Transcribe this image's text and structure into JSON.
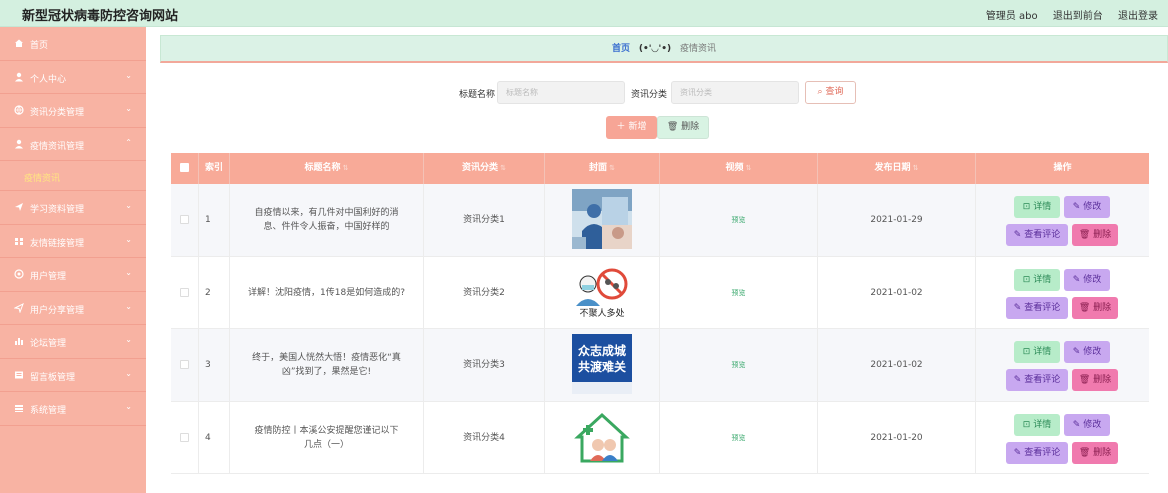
{
  "header": {
    "site_title": "新型冠状病毒防控咨询网站",
    "admin_label": "管理员 abo",
    "to_front_label": "退出到前台",
    "logout_label": "退出登录"
  },
  "sidebar": {
    "items": [
      {
        "label": "首页",
        "icon": "home-icon",
        "has_children": false
      },
      {
        "label": "个人中心",
        "icon": "user-icon",
        "has_children": true
      },
      {
        "label": "资讯分类管理",
        "icon": "globe-icon",
        "has_children": true
      },
      {
        "label": "疫情资讯管理",
        "icon": "user-icon",
        "has_children": true,
        "expanded": true,
        "children": [
          "疫情资讯"
        ]
      },
      {
        "label": "学习资料管理",
        "icon": "send-icon",
        "has_children": true
      },
      {
        "label": "友情链接管理",
        "icon": "grid-icon",
        "has_children": true
      },
      {
        "label": "用户管理",
        "icon": "circle-icon",
        "has_children": true
      },
      {
        "label": "用户分享管理",
        "icon": "send-icon",
        "has_children": true
      },
      {
        "label": "论坛管理",
        "icon": "chart-icon",
        "has_children": true
      },
      {
        "label": "留言板管理",
        "icon": "board-icon",
        "has_children": true
      },
      {
        "label": "系统管理",
        "icon": "system-icon",
        "has_children": true
      }
    ]
  },
  "breadcrumb": {
    "home": "首页",
    "face": "(•'◡'•)",
    "current": "疫情资讯"
  },
  "search": {
    "title_label": "标题名称",
    "title_placeholder": "标题名称",
    "category_label": "资讯分类",
    "category_placeholder": "资讯分类",
    "query_label": "查询"
  },
  "toolbar": {
    "add_label": "新增",
    "delete_label": "删除"
  },
  "table": {
    "columns": [
      "索引",
      "标题名称",
      "资讯分类",
      "封面",
      "视频",
      "发布日期",
      "操作"
    ],
    "rows": [
      {
        "index": "1",
        "title": "自疫情以来，有几件对中国利好的消息、件件令人振奋，中国好样的",
        "category": "资讯分类1",
        "video": "预览",
        "date": "2021-01-29"
      },
      {
        "index": "2",
        "title": "详解！沈阳疫情，1传18是如何造成的?",
        "category": "资讯分类2",
        "video": "预览",
        "date": "2021-01-02"
      },
      {
        "index": "3",
        "title": "终于，美国人恍然大悟！疫情恶化“真凶”找到了，果然是它!",
        "category": "资讯分类3",
        "video": "预览",
        "date": "2021-01-02"
      },
      {
        "index": "4",
        "title": "疫情防控丨本溪公安提醒您谨记以下几点（一）",
        "category": "资讯分类4",
        "video": "预览",
        "date": "2021-01-20"
      }
    ],
    "ops": {
      "detail": "详情",
      "edit": "修改",
      "comment": "查看评论",
      "remove": "删除"
    },
    "cover_texts": {
      "row2": "不聚人多处",
      "row3_line1": "众志成城",
      "row3_line2": "共渡难关"
    }
  }
}
